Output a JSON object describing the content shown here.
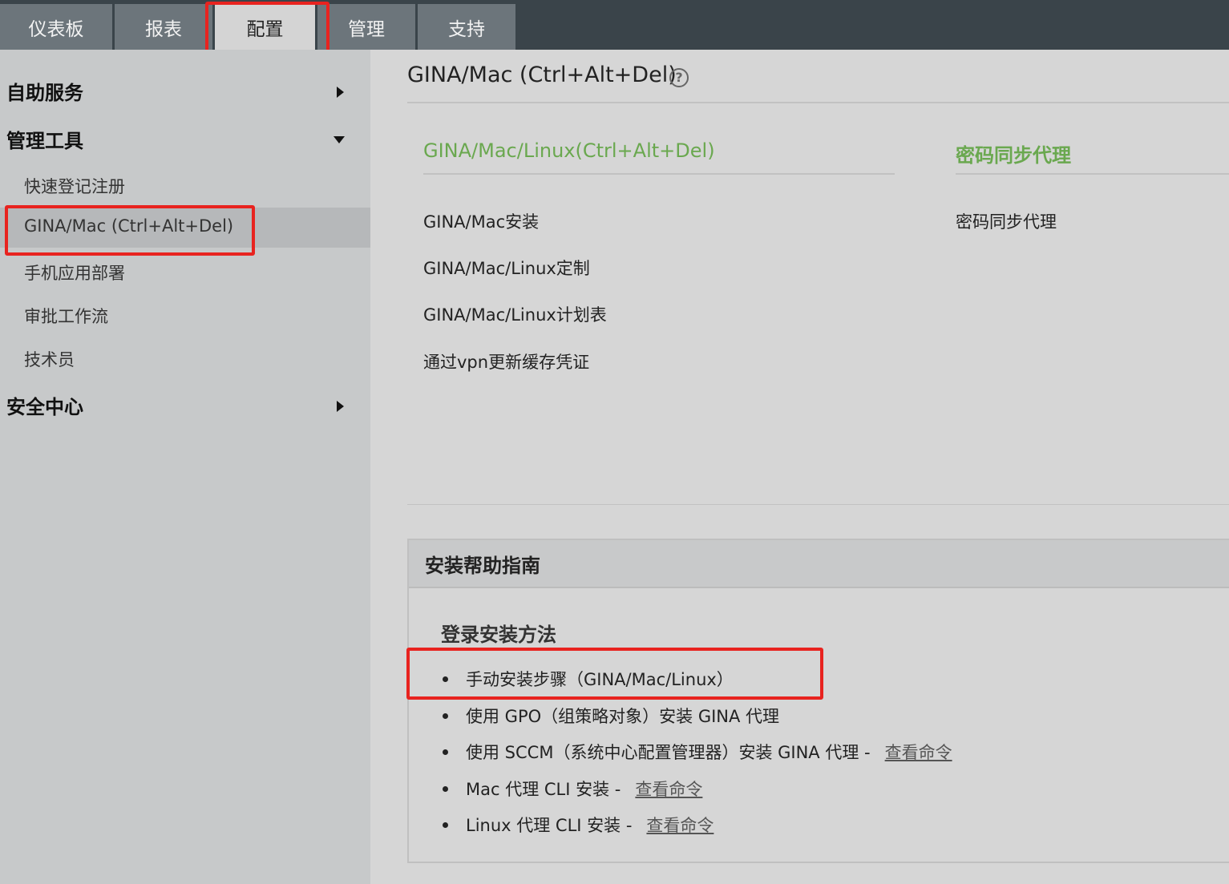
{
  "nav": {
    "tabs": [
      "仪表板",
      "报表",
      "配置",
      "管理",
      "支持"
    ],
    "active_tab": "配置"
  },
  "sidebar": {
    "sections": [
      {
        "label": "自助服务",
        "state": "collapsed"
      },
      {
        "label": "管理工具",
        "state": "expanded"
      },
      {
        "label": "安全中心",
        "state": "collapsed"
      }
    ],
    "items": [
      "快速登记注册",
      "GINA/Mac (Ctrl+Alt+Del)",
      "手机应用部署",
      "审批工作流",
      "技术员"
    ],
    "selected_item": "GINA/Mac (Ctrl+Alt+Del)"
  },
  "main": {
    "title": "GINA/Mac (Ctrl+Alt+Del)",
    "help_glyph": "?",
    "left_section": {
      "heading": "GINA/Mac/Linux(Ctrl+Alt+Del)",
      "links": [
        "GINA/Mac安装",
        "GINA/Mac/Linux定制",
        "GINA/Mac/Linux计划表",
        "通过vpn更新缓存凭证"
      ]
    },
    "right_section": {
      "heading": "密码同步代理",
      "links": [
        "密码同步代理"
      ]
    }
  },
  "guide": {
    "title": "安装帮助指南",
    "subtitle": "登录安装方法",
    "items": [
      {
        "text": "手动安装步骤（GINA/Mac/Linux）",
        "link": ""
      },
      {
        "text": "使用 GPO（组策略对象）安装 GINA 代理",
        "link": ""
      },
      {
        "text": "使用 SCCM（系统中心配置管理器）安装 GINA 代理 -",
        "link": "查看命令"
      },
      {
        "text": "Mac 代理 CLI 安装 -",
        "link": "查看命令"
      },
      {
        "text": "Linux 代理 CLI 安装 -",
        "link": "查看命令"
      }
    ]
  },
  "colors": {
    "topbar": "#3a444a",
    "tab": "#6c757b",
    "accent_green": "#6aa84f",
    "highlight_red": "#e8231f"
  }
}
